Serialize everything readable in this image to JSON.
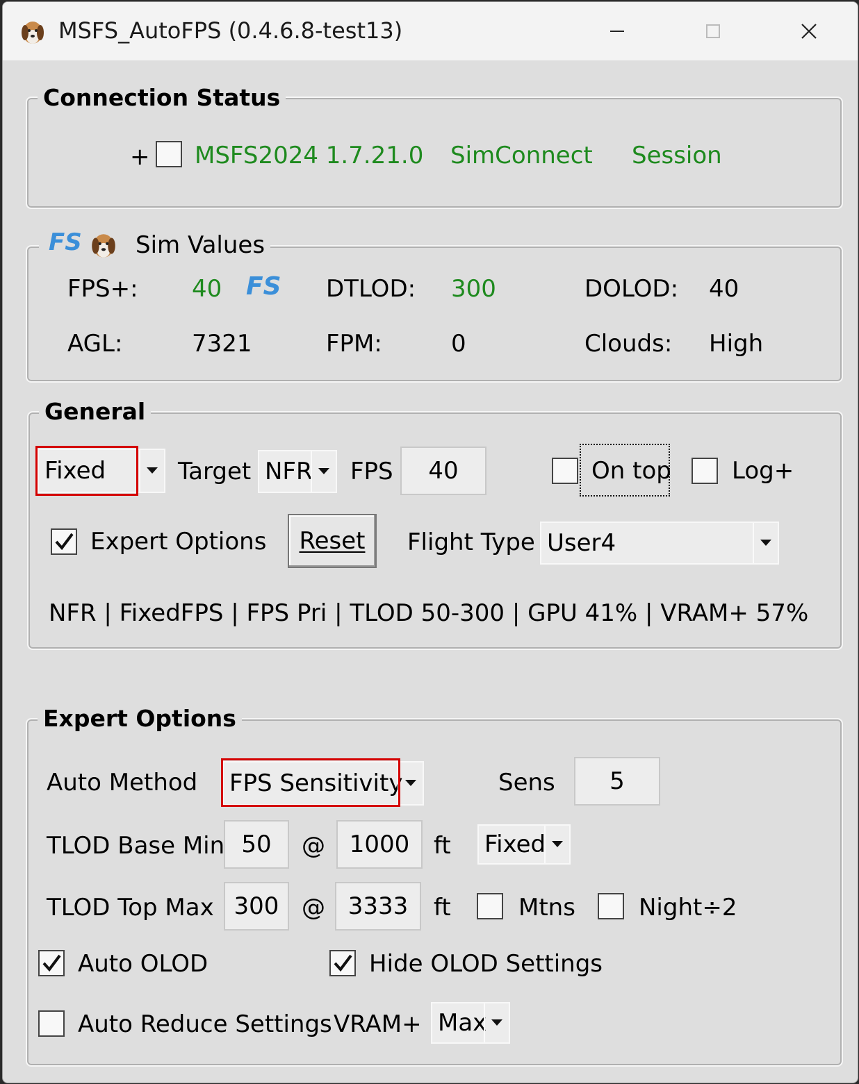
{
  "window": {
    "title": "MSFS_AutoFPS (0.4.6.8-test13)"
  },
  "connection": {
    "title": "Connection Status",
    "plus": "+",
    "sim": "MSFS2024 1.7.21.0",
    "simconnect": "SimConnect",
    "session": "Session"
  },
  "sim_values": {
    "title": "Sim Values",
    "fps_label": "FPS+:",
    "fps_value": "40",
    "dtlod_label": "DTLOD:",
    "dtlod_value": "300",
    "dolod_label": "DOLOD:",
    "dolod_value": "40",
    "agl_label": "AGL:",
    "agl_value": "7321",
    "fpm_label": "FPM:",
    "fpm_value": "0",
    "clouds_label": "Clouds:",
    "clouds_value": "High",
    "icon_fs_text": "FS"
  },
  "general": {
    "title": "General",
    "mode_value": "Fixed",
    "target_label": "Target",
    "target_value": "NFR",
    "fps_label": "FPS",
    "fps_value": "40",
    "on_top_label": "On top",
    "log_label": "Log+",
    "expert_label": "Expert Options",
    "reset_label": "Reset",
    "flight_type_label": "Flight Type",
    "flight_type_value": "User4",
    "summary": "NFR | FixedFPS | FPS Pri | TLOD 50-300 | GPU 41% | VRAM+ 57%"
  },
  "expert": {
    "title": "Expert Options",
    "auto_method_label": "Auto Method",
    "auto_method_value": "FPS Sensitivity",
    "sens_label": "Sens",
    "sens_value": "5",
    "tlod_base_label": "TLOD Base Min",
    "tlod_base_value": "50",
    "at": "@",
    "tlod_base_alt": "1000",
    "ft": "ft",
    "base_mode_value": "Fixed",
    "tlod_top_label": "TLOD Top Max",
    "tlod_top_value": "300",
    "tlod_top_alt": "3333",
    "mtns_label": "Mtns",
    "night_label": "Night÷2",
    "auto_olod_label": "Auto OLOD",
    "hide_olod_label": "Hide OLOD Settings",
    "auto_reduce_label": "Auto Reduce Settings",
    "vram_label": "VRAM+",
    "vram_value": "Max"
  },
  "colors": {
    "status_green": "#1e8a1e",
    "highlight_red": "#d40000",
    "fs_logo_blue": "#3b8fd9"
  }
}
